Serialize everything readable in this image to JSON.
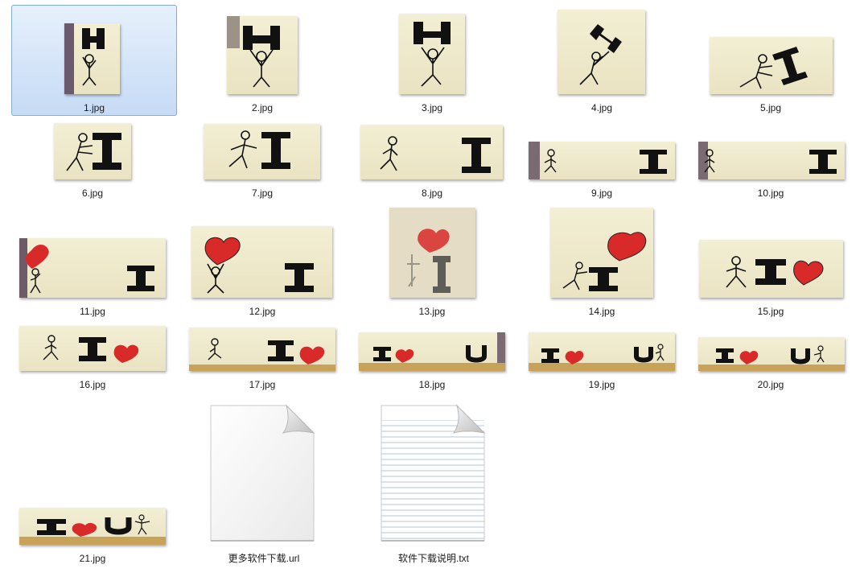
{
  "files": [
    {
      "name": "1.jpg"
    },
    {
      "name": "2.jpg"
    },
    {
      "name": "3.jpg"
    },
    {
      "name": "4.jpg"
    },
    {
      "name": "5.jpg"
    },
    {
      "name": "6.jpg"
    },
    {
      "name": "7.jpg"
    },
    {
      "name": "8.jpg"
    },
    {
      "name": "9.jpg"
    },
    {
      "name": "10.jpg"
    },
    {
      "name": "11.jpg"
    },
    {
      "name": "12.jpg"
    },
    {
      "name": "13.jpg"
    },
    {
      "name": "14.jpg"
    },
    {
      "name": "15.jpg"
    },
    {
      "name": "16.jpg"
    },
    {
      "name": "17.jpg"
    },
    {
      "name": "18.jpg"
    },
    {
      "name": "19.jpg"
    },
    {
      "name": "20.jpg"
    },
    {
      "name": "21.jpg"
    },
    {
      "name": "更多软件下载.url"
    },
    {
      "name": "软件下载说明.txt"
    }
  ],
  "selected_file": "1.jpg",
  "colors": {
    "selection_fill": "#cfe1f8",
    "selection_border": "#84acdd",
    "paper": "#efe9cc",
    "ink": "#161616",
    "heart": "#d92a2a"
  }
}
